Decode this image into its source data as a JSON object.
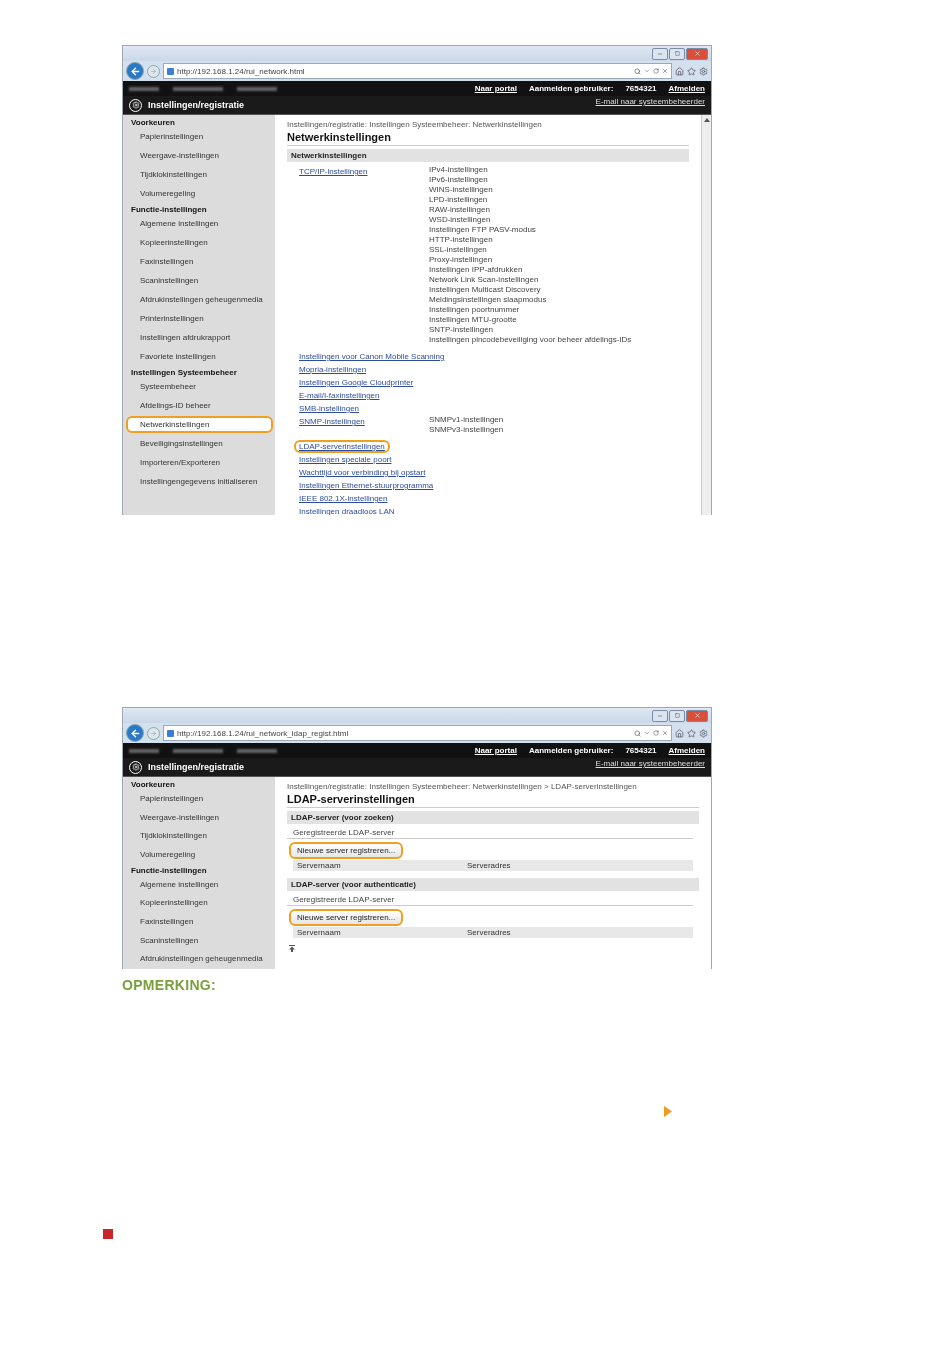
{
  "screenshots": [
    {
      "kind": "network",
      "url": "http://192.168.1.24/rui_network.html",
      "header": {
        "items": [
          {
            "text": "Naar portal",
            "kind": "link"
          },
          {
            "text": "Aanmelden gebruiker:",
            "kind": "label"
          },
          {
            "text": "7654321",
            "kind": "label"
          },
          {
            "text": "Afmelden",
            "kind": "link"
          }
        ],
        "app_title": "Instellingen/registratie",
        "mail_link": "E-mail naar systeembeheerder"
      },
      "sidebar": [
        {
          "heading": "Voorkeuren",
          "items": [
            {
              "label": "Papierinstellingen",
              "selected": false,
              "highlighted": false
            },
            {
              "label": "Weergave-instellingen",
              "selected": false,
              "highlighted": false
            },
            {
              "label": "Tijdklokinstellingen",
              "selected": false,
              "highlighted": false
            },
            {
              "label": "Volumeregeling",
              "selected": false,
              "highlighted": false
            }
          ]
        },
        {
          "heading": "Functie-instellingen",
          "items": [
            {
              "label": "Algemene instellingen",
              "selected": false,
              "highlighted": false
            },
            {
              "label": "Kopieerinstellingen",
              "selected": false,
              "highlighted": false
            },
            {
              "label": "Faxinstellingen",
              "selected": false,
              "highlighted": false
            },
            {
              "label": "Scaninstellingen",
              "selected": false,
              "highlighted": false
            },
            {
              "label": "Afdrukinstellingen geheugenmedia",
              "selected": false,
              "highlighted": false
            },
            {
              "label": "Printerinstellingen",
              "selected": false,
              "highlighted": false
            },
            {
              "label": "Instellingen afdrukrapport",
              "selected": false,
              "highlighted": false
            },
            {
              "label": "Favoriete instellingen",
              "selected": false,
              "highlighted": false
            }
          ]
        },
        {
          "heading": "Instellingen Systeembeheer",
          "items": [
            {
              "label": "Systeembeheer",
              "selected": false,
              "highlighted": false
            },
            {
              "label": "Afdelings-ID beheer",
              "selected": false,
              "highlighted": false
            },
            {
              "label": "Netwerkinstellingen",
              "selected": true,
              "highlighted": true
            },
            {
              "label": "Beveiligingsinstellingen",
              "selected": false,
              "highlighted": false
            },
            {
              "label": "Importeren/Exporteren",
              "selected": false,
              "highlighted": false
            },
            {
              "label": "Instellingengegevens initialiseren",
              "selected": false,
              "highlighted": false
            }
          ]
        }
      ],
      "breadcrumb": "Instellingen/registratie: Instellingen Systeembeheer: Netwerkinstellingen",
      "title": "Netwerkinstellingen",
      "section": "Netwerkinstellingen",
      "rows": [
        {
          "link": "TCP/IP-instellingen",
          "highlighted": false,
          "sub": [
            "IPv4-instellingen",
            "IPv6-instellingen",
            "WINS-instellingen",
            "LPD-instellingen",
            "RAW-instellingen",
            "WSD-instellingen",
            "Instellingen FTP PASV-modus",
            "HTTP-instellingen",
            "SSL-instellingen",
            "Proxy-instellingen",
            "Instellingen IPP-afdrukken",
            "Network Link Scan-instellingen",
            "Instellingen Multicast Discovery",
            "Meldingsinstellingen slaapmodus",
            "Instellingen poortnummer",
            "Instellingen MTU-grootte",
            "SNTP-instellingen",
            "Instellingen pincodebeveiliging voor beheer afdelings-IDs"
          ]
        },
        {
          "link": "Instellingen voor Canon Mobile Scanning",
          "highlighted": false
        },
        {
          "link": "Mopria-instellingen",
          "highlighted": false
        },
        {
          "link": "Instellingen Google Cloudprinter",
          "highlighted": false
        },
        {
          "link": "E-mail/I-faxinstellingen",
          "highlighted": false
        },
        {
          "link": "SMB-instellingen",
          "highlighted": false
        },
        {
          "link": "SNMP-instellingen",
          "highlighted": false,
          "sub": [
            "SNMPv1-instellingen",
            "SNMPv3-instellingen"
          ]
        },
        {
          "link": "LDAP-serverinstellingen",
          "highlighted": true
        },
        {
          "link": "Instellingen speciale poort",
          "highlighted": false
        },
        {
          "link": "Wachttijd voor verbinding bij opstart",
          "highlighted": false
        },
        {
          "link": "Instellingen Ethernet-stuurprogramma",
          "highlighted": false
        },
        {
          "link": "IEEE 802.1X-instellingen",
          "highlighted": false
        },
        {
          "link": "Instellingen draadloos LAN",
          "highlighted": false
        }
      ]
    },
    {
      "kind": "ldap",
      "url": "http://192.168.1.24/rui_network_ldap_regist.html",
      "header": {
        "items": [
          {
            "text": "Naar portal",
            "kind": "link"
          },
          {
            "text": "Aanmelden gebruiker:",
            "kind": "label"
          },
          {
            "text": "7654321",
            "kind": "label"
          },
          {
            "text": "Afmelden",
            "kind": "link"
          }
        ],
        "app_title": "Instellingen/registratie",
        "mail_link": "E-mail naar systeembeheerder"
      },
      "sidebar": [
        {
          "heading": "Voorkeuren",
          "items": [
            {
              "label": "Papierinstellingen",
              "selected": false,
              "highlighted": false
            },
            {
              "label": "Weergave-instellingen",
              "selected": false,
              "highlighted": false
            },
            {
              "label": "Tijdklokinstellingen",
              "selected": false,
              "highlighted": false
            },
            {
              "label": "Volumeregeling",
              "selected": false,
              "highlighted": false
            }
          ]
        },
        {
          "heading": "Functie-instellingen",
          "items": [
            {
              "label": "Algemene instellingen",
              "selected": false,
              "highlighted": false
            },
            {
              "label": "Kopieerinstellingen",
              "selected": false,
              "highlighted": false
            },
            {
              "label": "Faxinstellingen",
              "selected": false,
              "highlighted": false
            },
            {
              "label": "Scaninstellingen",
              "selected": false,
              "highlighted": false
            },
            {
              "label": "Afdrukinstellingen geheugenmedia",
              "selected": false,
              "highlighted": false
            }
          ]
        }
      ],
      "breadcrumb": "Instellingen/registratie: Instellingen Systeembeheer: Netwerkinstellingen > LDAP-serverinstellingen",
      "title": "LDAP-serverinstellingen",
      "groups": [
        {
          "heading": "LDAP-server (voor zoeken)",
          "subheading": "Geregistreerde LDAP-server",
          "button": {
            "label": "Nieuwe server registreren...",
            "highlighted": true
          },
          "columns": [
            "Servernaam",
            "Serveradres"
          ]
        },
        {
          "heading": "LDAP-server (voor authenticatie)",
          "subheading": "Geregistreerde LDAP-server",
          "button": {
            "label": "Nieuwe server registreren...",
            "highlighted": true
          },
          "columns": [
            "Servernaam",
            "Serveradres"
          ]
        }
      ]
    }
  ],
  "note_heading": "OPMERKING:"
}
